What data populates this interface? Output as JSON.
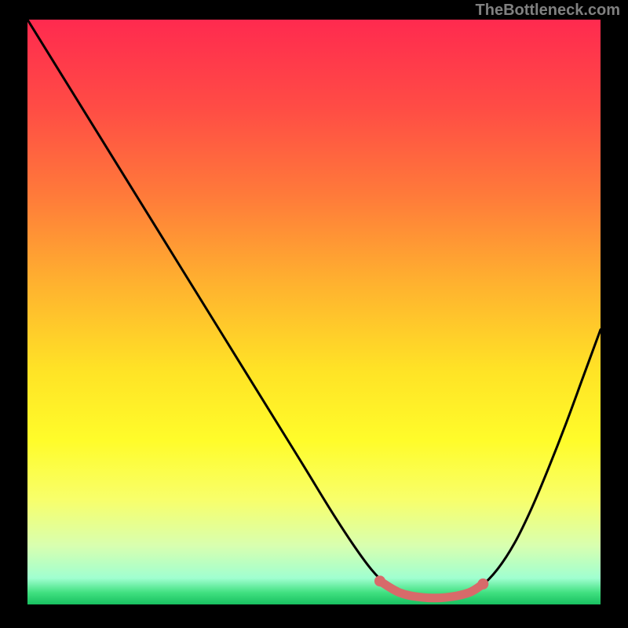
{
  "watermark": "TheBottleneck.com",
  "chart_data": {
    "type": "line",
    "title": "",
    "xlabel": "",
    "ylabel": "",
    "xlim": [
      0,
      1
    ],
    "ylim": [
      0,
      1
    ],
    "gradient_stops": [
      {
        "offset": 0.0,
        "color": "#ff2a4f"
      },
      {
        "offset": 0.15,
        "color": "#ff4c45"
      },
      {
        "offset": 0.3,
        "color": "#ff7a3a"
      },
      {
        "offset": 0.45,
        "color": "#ffb12f"
      },
      {
        "offset": 0.6,
        "color": "#ffe326"
      },
      {
        "offset": 0.72,
        "color": "#fffc2a"
      },
      {
        "offset": 0.82,
        "color": "#f8ff6a"
      },
      {
        "offset": 0.9,
        "color": "#d8ffb0"
      },
      {
        "offset": 0.955,
        "color": "#a0ffd0"
      },
      {
        "offset": 0.98,
        "color": "#40e080"
      },
      {
        "offset": 1.0,
        "color": "#18c060"
      }
    ],
    "series": [
      {
        "name": "bottleneck-curve",
        "color": "#000000",
        "points": [
          {
            "x": 0.0,
            "y": 1.0
          },
          {
            "x": 0.06,
            "y": 0.905
          },
          {
            "x": 0.12,
            "y": 0.81
          },
          {
            "x": 0.18,
            "y": 0.715
          },
          {
            "x": 0.24,
            "y": 0.62
          },
          {
            "x": 0.3,
            "y": 0.525
          },
          {
            "x": 0.36,
            "y": 0.43
          },
          {
            "x": 0.42,
            "y": 0.335
          },
          {
            "x": 0.48,
            "y": 0.24
          },
          {
            "x": 0.53,
            "y": 0.16
          },
          {
            "x": 0.57,
            "y": 0.1
          },
          {
            "x": 0.6,
            "y": 0.06
          },
          {
            "x": 0.625,
            "y": 0.035
          },
          {
            "x": 0.65,
            "y": 0.02
          },
          {
            "x": 0.68,
            "y": 0.012
          },
          {
            "x": 0.72,
            "y": 0.01
          },
          {
            "x": 0.76,
            "y": 0.015
          },
          {
            "x": 0.79,
            "y": 0.03
          },
          {
            "x": 0.82,
            "y": 0.06
          },
          {
            "x": 0.85,
            "y": 0.105
          },
          {
            "x": 0.88,
            "y": 0.165
          },
          {
            "x": 0.91,
            "y": 0.235
          },
          {
            "x": 0.94,
            "y": 0.31
          },
          {
            "x": 0.97,
            "y": 0.39
          },
          {
            "x": 1.0,
            "y": 0.47
          }
        ]
      },
      {
        "name": "highlight-band",
        "color": "#d86a6a",
        "points": [
          {
            "x": 0.615,
            "y": 0.04
          },
          {
            "x": 0.65,
            "y": 0.02
          },
          {
            "x": 0.69,
            "y": 0.012
          },
          {
            "x": 0.73,
            "y": 0.012
          },
          {
            "x": 0.77,
            "y": 0.02
          },
          {
            "x": 0.795,
            "y": 0.035
          }
        ]
      }
    ],
    "marker_dots": [
      {
        "x": 0.615,
        "y": 0.04,
        "color": "#d86a6a"
      },
      {
        "x": 0.795,
        "y": 0.035,
        "color": "#d86a6a"
      }
    ]
  }
}
